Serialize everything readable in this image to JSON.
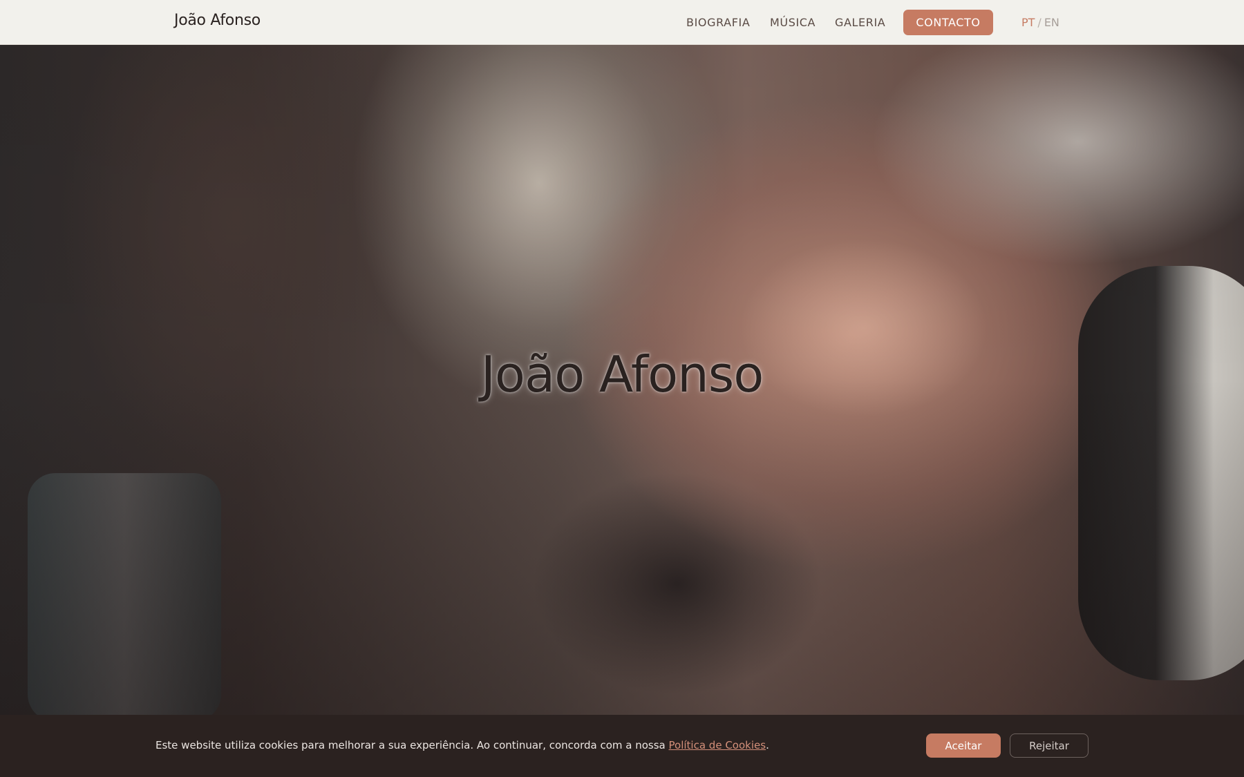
{
  "header": {
    "brand": "João Afonso",
    "nav": {
      "biografia": "BIOGRAFIA",
      "musica": "MÚSICA",
      "galeria": "GALERIA",
      "contacto": "CONTACTO"
    },
    "lang": {
      "pt": "PT",
      "separator": "/",
      "en": "EN"
    }
  },
  "hero": {
    "title": "João Afonso"
  },
  "cookie_banner": {
    "text": "Este website utiliza cookies para melhorar a sua experiência. Ao continuar, concorda com a nossa ",
    "link_label": "Política de Cookies",
    "trailing": ".",
    "accept_label": "Aceitar",
    "reject_label": "Rejeitar"
  },
  "colors": {
    "accent": "#c67b62",
    "header_bg": "#f2f1ec",
    "banner_bg": "#2b2220",
    "text_dark": "#2a2220"
  }
}
